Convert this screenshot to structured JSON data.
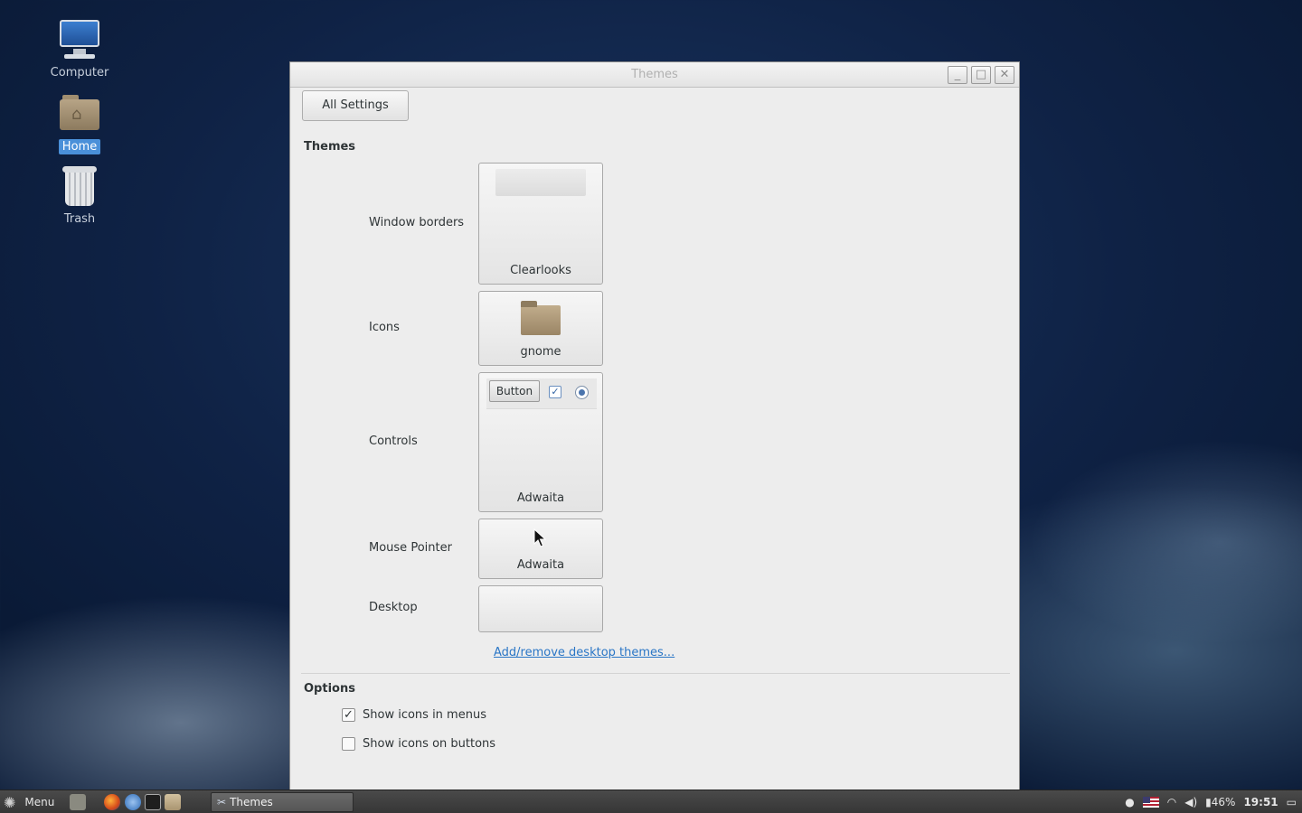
{
  "desktop": {
    "icons": [
      {
        "label": "Computer",
        "icon": "computer-icon"
      },
      {
        "label": "Home",
        "icon": "home-folder-icon"
      },
      {
        "label": "Trash",
        "icon": "trash-icon"
      }
    ]
  },
  "window": {
    "title": "Themes",
    "controls": {
      "minimize": "_",
      "maximize": "□",
      "close": "✕"
    },
    "all_settings_label": "All Settings",
    "themes_section": {
      "title": "Themes",
      "rows": [
        {
          "label": "Window borders",
          "value": "Clearlooks"
        },
        {
          "label": "Icons",
          "value": "gnome"
        },
        {
          "label": "Controls",
          "value": "Adwaita",
          "preview_button": "Button"
        },
        {
          "label": "Mouse Pointer",
          "value": "Adwaita"
        },
        {
          "label": "Desktop",
          "value": ""
        }
      ],
      "link": "Add/remove desktop themes..."
    },
    "options_section": {
      "title": "Options",
      "items": [
        {
          "label": "Show icons in menus",
          "checked": true
        },
        {
          "label": "Show icons on buttons",
          "checked": false
        }
      ]
    }
  },
  "taskbar": {
    "menu_label": "Menu",
    "task_label": "Themes",
    "battery": "46%",
    "clock": "19:51"
  },
  "colors": {
    "accent": "#4a90d9",
    "link": "#2a76c6"
  }
}
